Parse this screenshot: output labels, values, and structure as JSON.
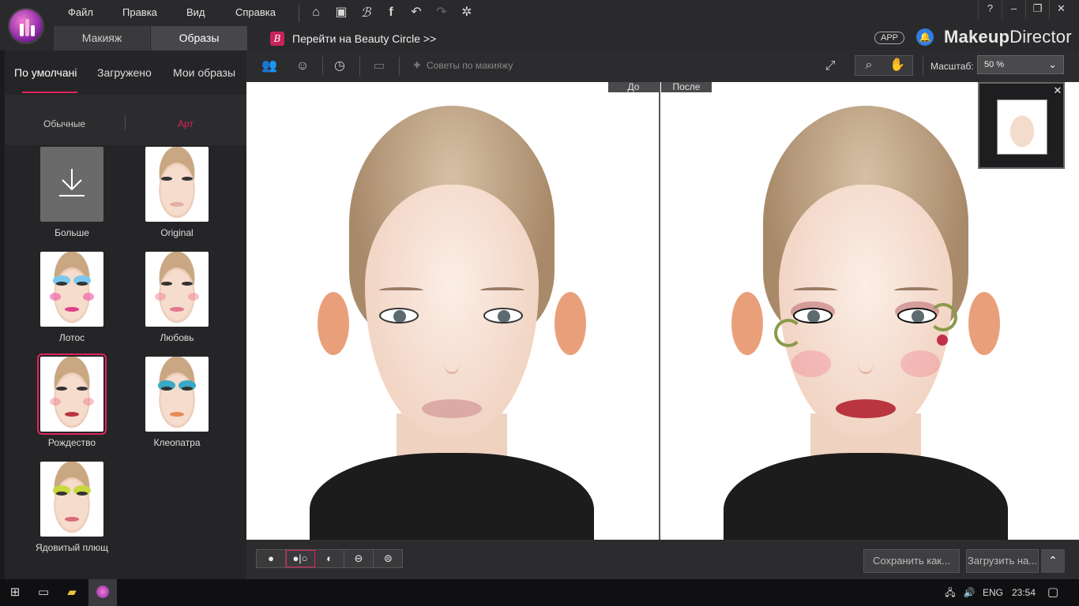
{
  "menu": {
    "items": [
      "Файл",
      "Правка",
      "Вид",
      "Справка"
    ]
  },
  "toolbar_top": {
    "icons": [
      "home-icon",
      "save-icon",
      "beauty-circle-icon",
      "facebook-icon",
      "undo-icon",
      "redo-icon",
      "settings-icon"
    ]
  },
  "window": {
    "help": "?",
    "minimize": "–",
    "restore": "❐",
    "close": "✕"
  },
  "tabs": {
    "makeup": "Макияж",
    "looks": "Образы"
  },
  "beauty_circle": {
    "badge": "B",
    "link": "Перейти на Beauty Circle >>"
  },
  "brand": {
    "app_badge": "APP",
    "name_bold": "Makeup",
    "name_rest": "Director"
  },
  "left": {
    "tabs": [
      "По умолчані",
      "Загружено",
      "Мои образы"
    ],
    "subtabs": [
      "Обычные",
      "Арт"
    ],
    "accent": "#e0245e",
    "looks": [
      {
        "label": "Больше",
        "type": "more"
      },
      {
        "label": "Original"
      },
      {
        "label": "Лотос"
      },
      {
        "label": "Любовь"
      },
      {
        "label": "Рождество",
        "selected": true
      },
      {
        "label": "Клеопатра"
      },
      {
        "label": "Ядовитый плющ"
      }
    ]
  },
  "tools": {
    "tips": "Советы по макияжу",
    "zoom_label": "Масштаб:",
    "zoom_value": "50 %"
  },
  "canvas": {
    "before": "До",
    "after": "После"
  },
  "bottom": {
    "save_as": "Сохранить как...",
    "upload": "Загрузить на...",
    "up": "⌃"
  },
  "taskbar": {
    "lang": "ENG",
    "time": "23:54"
  }
}
